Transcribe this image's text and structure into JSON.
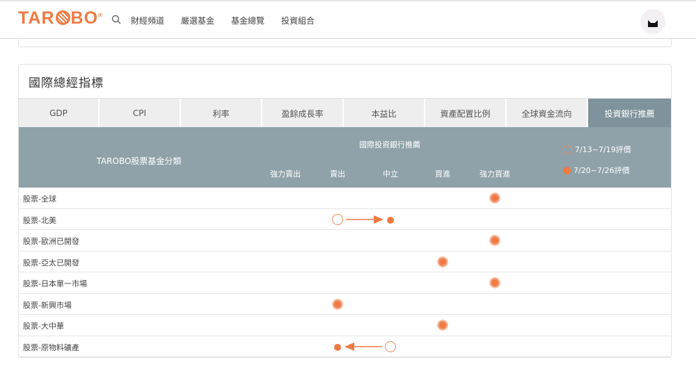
{
  "nav": {
    "logo": {
      "left": "TAR",
      "right": "BO",
      "reg": "®"
    },
    "links": [
      "財經頻道",
      "嚴選基金",
      "基金總覽",
      "投資組合"
    ]
  },
  "card": {
    "title": "國際總經指標",
    "tabs": [
      "GDP",
      "CPI",
      "利率",
      "盈餘成長率",
      "本益比",
      "資產配置比例",
      "全球資金流向",
      "投資銀行推薦"
    ],
    "active_tab_index": 7
  },
  "table": {
    "category_header": "TAROBO股票基金分類",
    "group_header": "國際投資銀行推薦",
    "columns": [
      "強力賣出",
      "賣出",
      "中立",
      "買進",
      "強力買進"
    ],
    "legend": {
      "previous": "7/13~7/19評價",
      "current": "7/20~7/26評價"
    },
    "rows": [
      {
        "label": "股票-全球",
        "previous": null,
        "current": "強力買進"
      },
      {
        "label": "股票-北美",
        "previous": "賣出",
        "current": "中立"
      },
      {
        "label": "股票-歐洲已開發",
        "previous": null,
        "current": "強力買進"
      },
      {
        "label": "股票-亞太已開發",
        "previous": null,
        "current": "買進"
      },
      {
        "label": "股票-日本單一市場",
        "previous": null,
        "current": "強力買進"
      },
      {
        "label": "股票-新興市場",
        "previous": null,
        "current": "賣出"
      },
      {
        "label": "股票-大中華",
        "previous": null,
        "current": "買進"
      },
      {
        "label": "股票-原物料礦產",
        "previous": "中立",
        "current": "賣出"
      }
    ]
  },
  "colors": {
    "brand": "#f07a42",
    "header_bg": "#8fa2aa",
    "active_tab": "#7e939c",
    "tab_bg": "#eeeeee"
  }
}
